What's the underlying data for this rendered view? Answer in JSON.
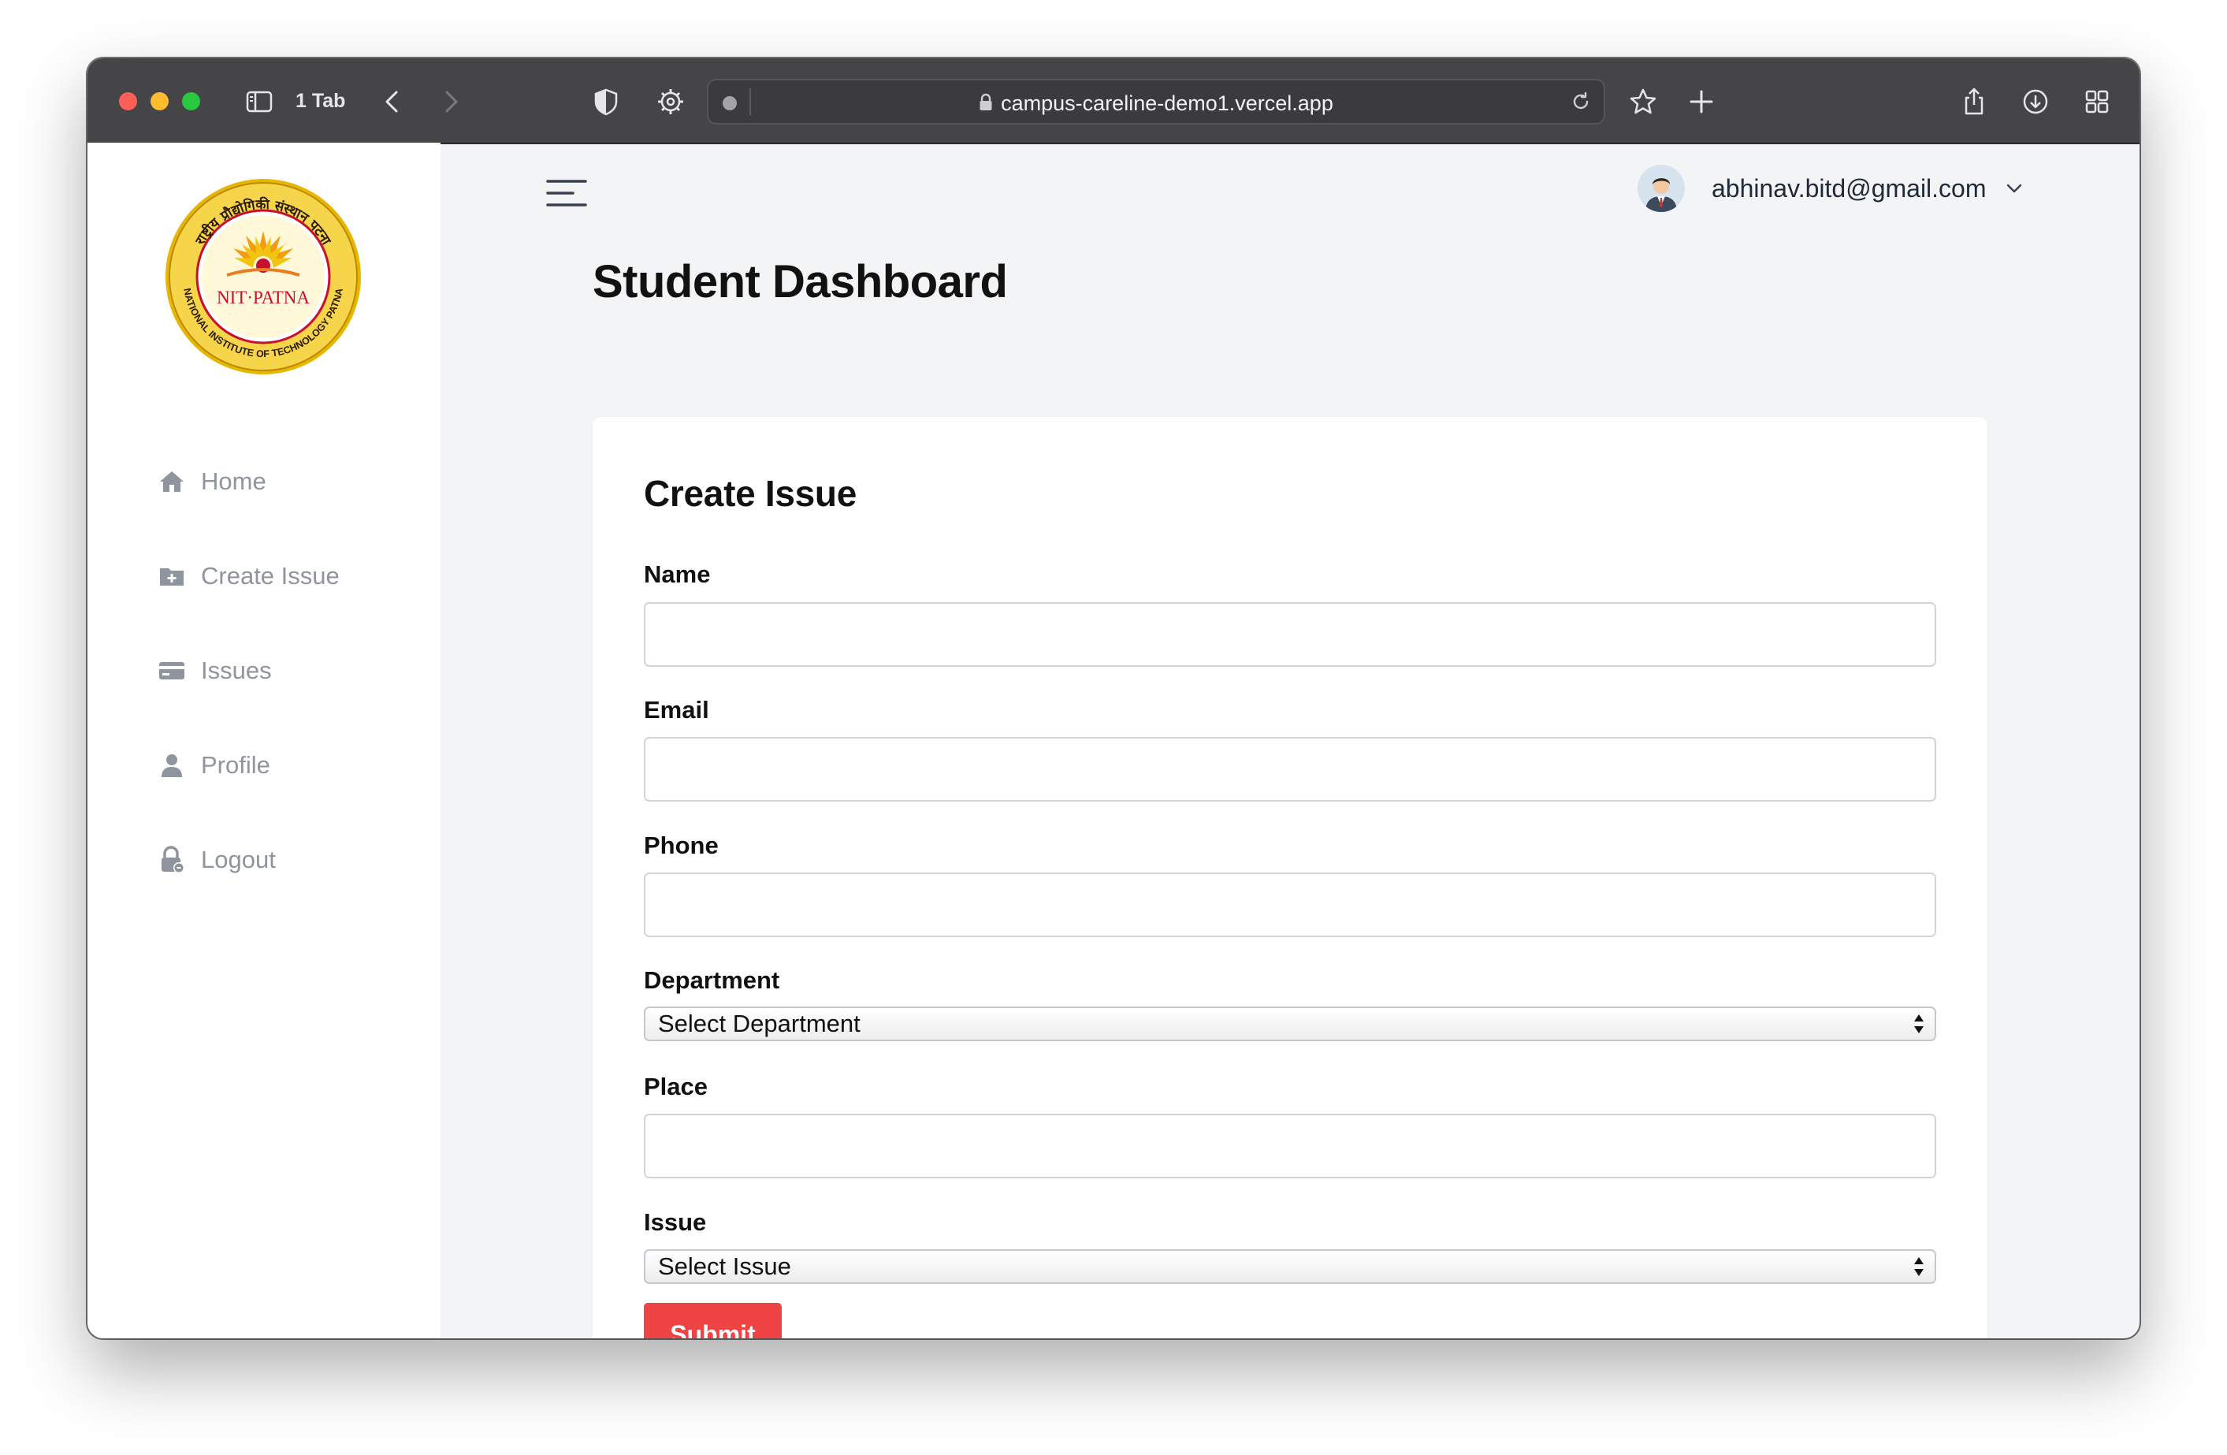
{
  "browser": {
    "tab_count": "1 Tab",
    "url": "campus-careline-demo1.vercel.app",
    "icons": [
      "sidebar-toggle-icon",
      "back-icon",
      "forward-icon",
      "shield-icon",
      "extension-icon",
      "lock-icon",
      "reload-icon",
      "star-icon",
      "new-tab-icon",
      "share-icon",
      "download-icon",
      "tab-overview-icon"
    ]
  },
  "sidebar": {
    "logo": {
      "text_top": "राष्ट्रीय प्रौद्योगिकी संस्थान पटना",
      "text_center": "NIT·PATNA",
      "text_bottom": "NATIONAL INSTITUTE OF TECHNOLOGY PATNA"
    },
    "items": [
      {
        "label": "Home",
        "icon": "home-icon"
      },
      {
        "label": "Create Issue",
        "icon": "folder-plus-icon"
      },
      {
        "label": "Issues",
        "icon": "card-icon"
      },
      {
        "label": "Profile",
        "icon": "user-icon"
      },
      {
        "label": "Logout",
        "icon": "lock-icon"
      }
    ]
  },
  "header": {
    "user_email": "abhinav.bitd@gmail.com"
  },
  "page": {
    "title": "Student Dashboard"
  },
  "form": {
    "title": "Create Issue",
    "name_label": "Name",
    "name_value": "",
    "email_label": "Email",
    "email_value": "",
    "phone_label": "Phone",
    "phone_value": "",
    "department_label": "Department",
    "department_selected": "Select Department",
    "place_label": "Place",
    "place_value": "",
    "issue_label": "Issue",
    "issue_selected": "Select Issue",
    "submit_label": "Submit"
  },
  "colors": {
    "accent": "#ef4444",
    "sidebar_text": "#8e959f",
    "background": "#f3f4f6",
    "logo_gold": "#e8b600",
    "logo_red": "#c8102e"
  }
}
